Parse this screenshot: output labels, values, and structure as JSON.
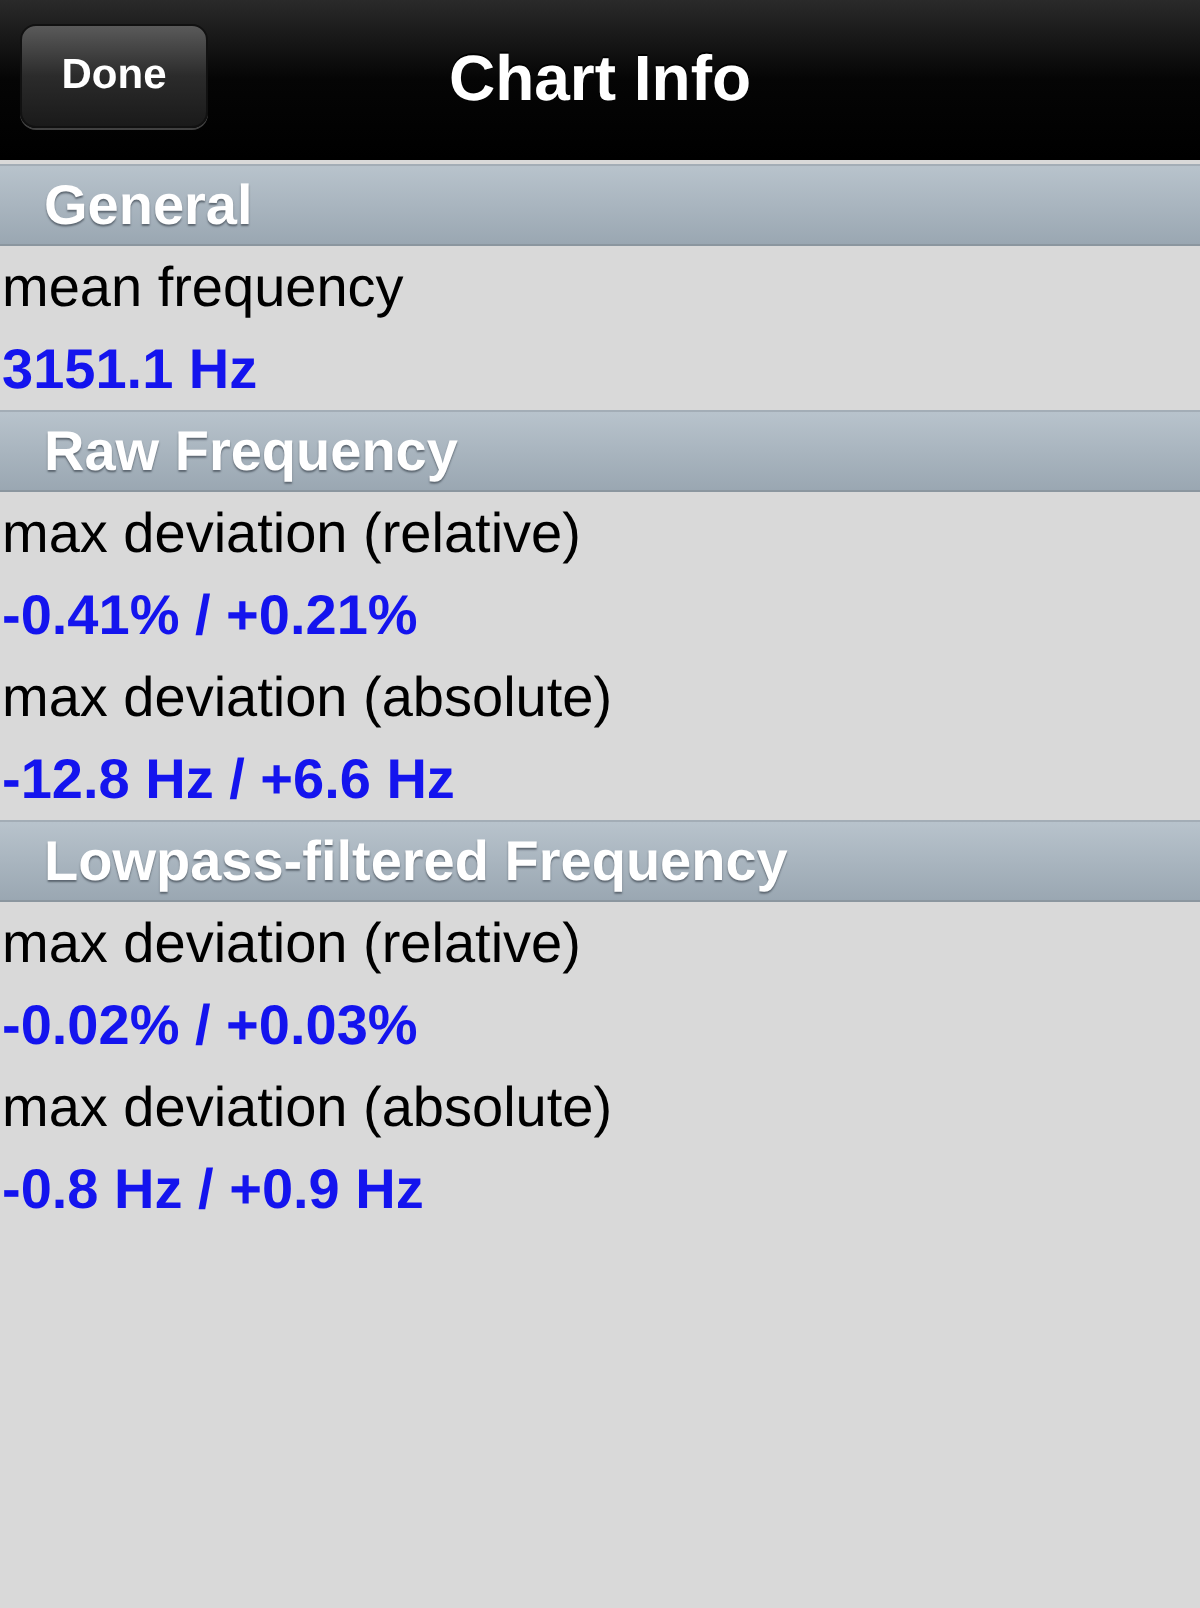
{
  "navigation_bar": {
    "title": "Chart Info",
    "done_button": "Done"
  },
  "sections": [
    {
      "title": "General",
      "items": [
        {
          "label": "mean frequency",
          "value": "3151.1 Hz"
        }
      ]
    },
    {
      "title": "Raw Frequency",
      "items": [
        {
          "label": "max deviation (relative)",
          "value": "-0.41% / +0.21%"
        },
        {
          "label": "max deviation (absolute)",
          "value": "-12.8 Hz / +6.6 Hz"
        }
      ]
    },
    {
      "title": "Lowpass-filtered Frequency",
      "items": [
        {
          "label": "max deviation (relative)",
          "value": "-0.02% / +0.03%"
        },
        {
          "label": "max deviation (absolute)",
          "value": "-0.8 Hz / +0.9 Hz"
        }
      ]
    }
  ]
}
